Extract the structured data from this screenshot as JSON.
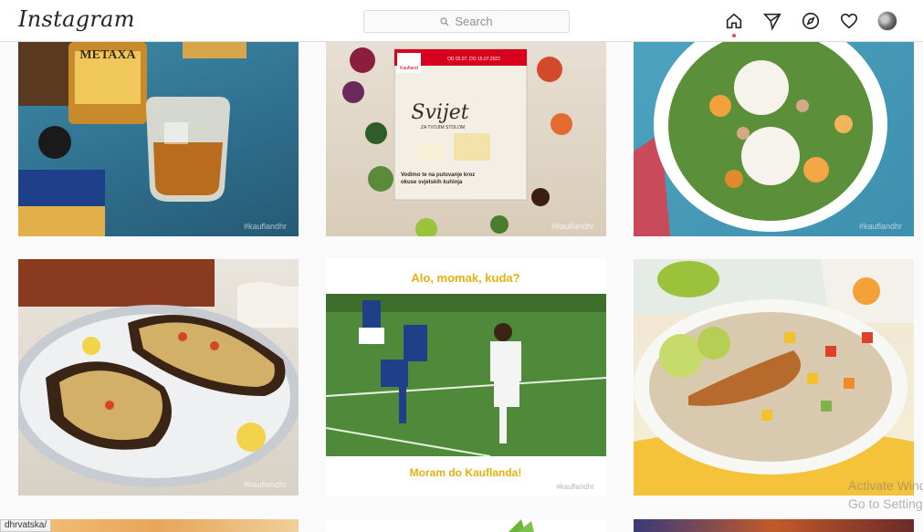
{
  "app": {
    "logo_text": "Instagram"
  },
  "search": {
    "placeholder": "Search"
  },
  "nav": {
    "icons": [
      "home-icon",
      "direct-icon",
      "explore-icon",
      "activity-icon",
      "avatar"
    ],
    "active_color": "#ed4956"
  },
  "posts": {
    "tile1": {
      "brand": "METAXA",
      "watermark": "#kauflandhr"
    },
    "tile2": {
      "header": "OD 02.07. DO 15.07.2022",
      "title": "Svijet",
      "subtitle": "ZA TVOJIM STOLOM",
      "caption": "Vodimo te na putovanje kroz okuse svjetskih kuhinja",
      "brand": "Kaufland",
      "watermark": "#kauflandhr"
    },
    "tile3": {
      "watermark": "#kauflandhr"
    },
    "tile4": {
      "watermark": "#kauflandhr"
    },
    "tile5": {
      "top_text": "Alo, momak, kuda?",
      "bottom_text": "Moram do Kauflanda!",
      "watermark": "#kauflandhr"
    },
    "tile6": {
      "watermark": ""
    }
  },
  "overlay": {
    "status_url": "dhrvatska/",
    "activate_line1": "Activate Windows",
    "activate_line2": "Go to Settings"
  }
}
